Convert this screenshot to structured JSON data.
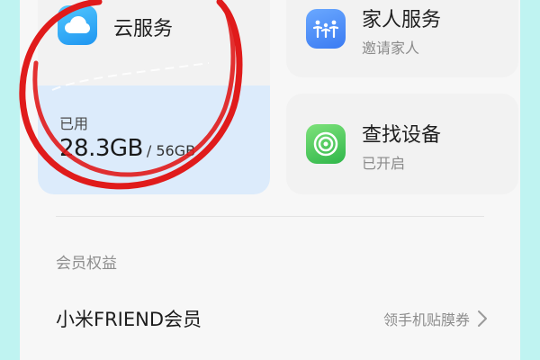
{
  "cloud_card": {
    "title": "云服务",
    "used_label": "已用",
    "used_amount": "28.3GB",
    "total_amount": "/ 56GB",
    "usage_fraction": 0.505
  },
  "family_card": {
    "title": "家人服务",
    "subtitle": "邀请家人"
  },
  "find_device_card": {
    "title": "查找设备",
    "subtitle": "已开启"
  },
  "membership_section": {
    "label": "会员权益",
    "item_title": "小米FRIEND会员",
    "item_promo": "领手机贴膜券"
  },
  "colors": {
    "background": "#bff3f1",
    "annotation_circle": "#e01b1b",
    "cloud_icon": "#2aa8f5",
    "family_icon": "#4a8df5",
    "find_icon": "#3cc05a",
    "storage_panel": "#dcebfb"
  },
  "icons": {
    "cloud": "cloud-icon",
    "family": "family-people-icon",
    "find": "radar-locate-icon",
    "chevron": "chevron-right-icon"
  }
}
